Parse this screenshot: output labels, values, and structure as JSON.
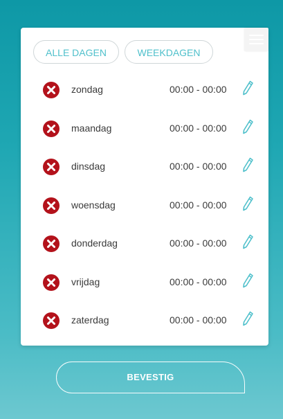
{
  "filters": {
    "all_days": "ALLE DAGEN",
    "weekdays": "WEEKDAGEN"
  },
  "days": [
    {
      "name": "zondag",
      "time": "00:00 - 00:00"
    },
    {
      "name": "maandag",
      "time": "00:00 - 00:00"
    },
    {
      "name": "dinsdag",
      "time": "00:00 - 00:00"
    },
    {
      "name": "woensdag",
      "time": "00:00 - 00:00"
    },
    {
      "name": "donderdag",
      "time": "00:00 - 00:00"
    },
    {
      "name": "vrijdag",
      "time": "00:00 - 00:00"
    },
    {
      "name": "zaterdag",
      "time": "00:00 - 00:00"
    }
  ],
  "confirm_label": "BEVESTIG",
  "icons": {
    "remove": "remove-icon",
    "edit": "pencil-icon",
    "menu": "hamburger-icon"
  },
  "colors": {
    "accent": "#4fc0cb",
    "remove": "#b3121b",
    "background_top": "#0e98a6",
    "background_bottom": "#6dc8d0"
  }
}
